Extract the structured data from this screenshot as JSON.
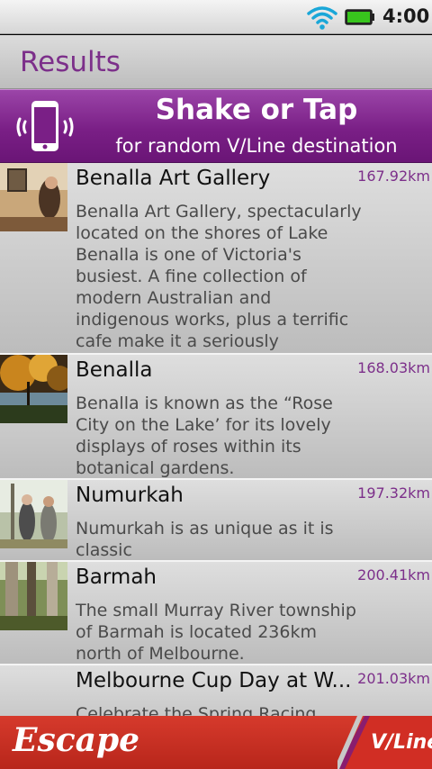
{
  "status_bar": {
    "time": "4:00",
    "icons": [
      "wifi-icon",
      "battery-icon"
    ]
  },
  "header": {
    "title": "Results"
  },
  "banner": {
    "headline": "Shake or Tap",
    "subtext": "for random V/Line destination",
    "icon": "shake-phone-icon"
  },
  "results": [
    {
      "name": "Benalla Art Gallery",
      "distance": "167.92km",
      "description": "Benalla Art Gallery, spectacularly located on the shores of Lake Benalla is one of Victoria's busiest. A fine collection of modern Australian and indigenous works, plus a terrific cafe make it a seriously enjoyable experience."
    },
    {
      "name": "Benalla",
      "distance": "168.03km",
      "description": "Benalla is known as the “Rose City on the Lake’ for its lovely displays of roses within its botanical gardens."
    },
    {
      "name": "Numurkah",
      "distance": "197.32km",
      "description": "Numurkah is as unique as it is classic"
    },
    {
      "name": "Barmah",
      "distance": "200.41km",
      "description": "The small Murray River township of Barmah is located 236km north of Melbourne."
    },
    {
      "name": "Melbourne Cup Day at W...",
      "distance": "201.03km",
      "description": "Celebrate the Spring Racing"
    }
  ],
  "footer": {
    "brand": "Escape",
    "partner": "V/Line"
  },
  "colors": {
    "accent": "#7c2f8a",
    "banner": "#7a1f86",
    "footer": "#c42e22"
  }
}
